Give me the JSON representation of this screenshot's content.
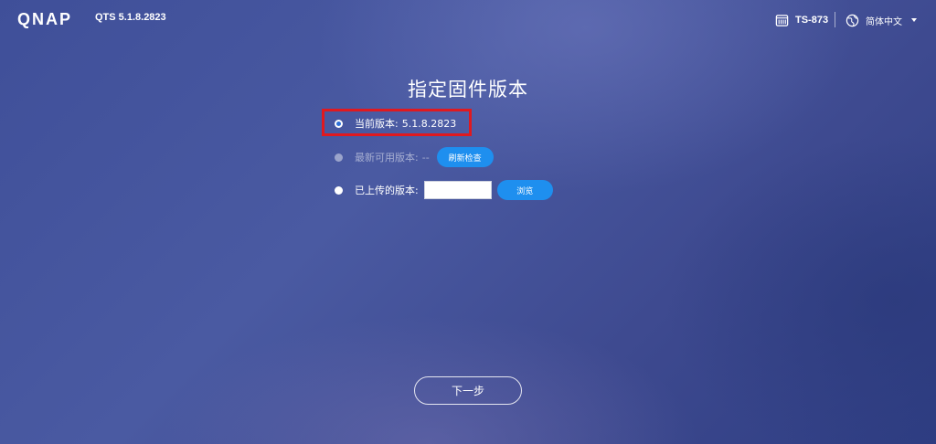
{
  "header": {
    "logo": "QNAP",
    "os_version": "QTS 5.1.8.2823",
    "device_name": "TS-873",
    "device_icon": "nas-device-icon",
    "language": "简体中文",
    "language_icon": "globe-icon",
    "language_caret_icon": "caret-down-icon"
  },
  "page": {
    "title": "指定固件版本"
  },
  "options": {
    "current": {
      "label": "当前版本:",
      "value": "5.1.8.2823",
      "selected": true
    },
    "latest": {
      "label": "最新可用版本:",
      "value": "--",
      "button": "刷新检查",
      "disabled": true
    },
    "uploaded": {
      "label": "已上传的版本:",
      "input_value": "",
      "button": "浏览"
    }
  },
  "footer": {
    "next_button": "下一步"
  },
  "colors": {
    "accent": "#1e8fef",
    "highlight_border": "#e0191f",
    "background": "#3f4f99"
  }
}
